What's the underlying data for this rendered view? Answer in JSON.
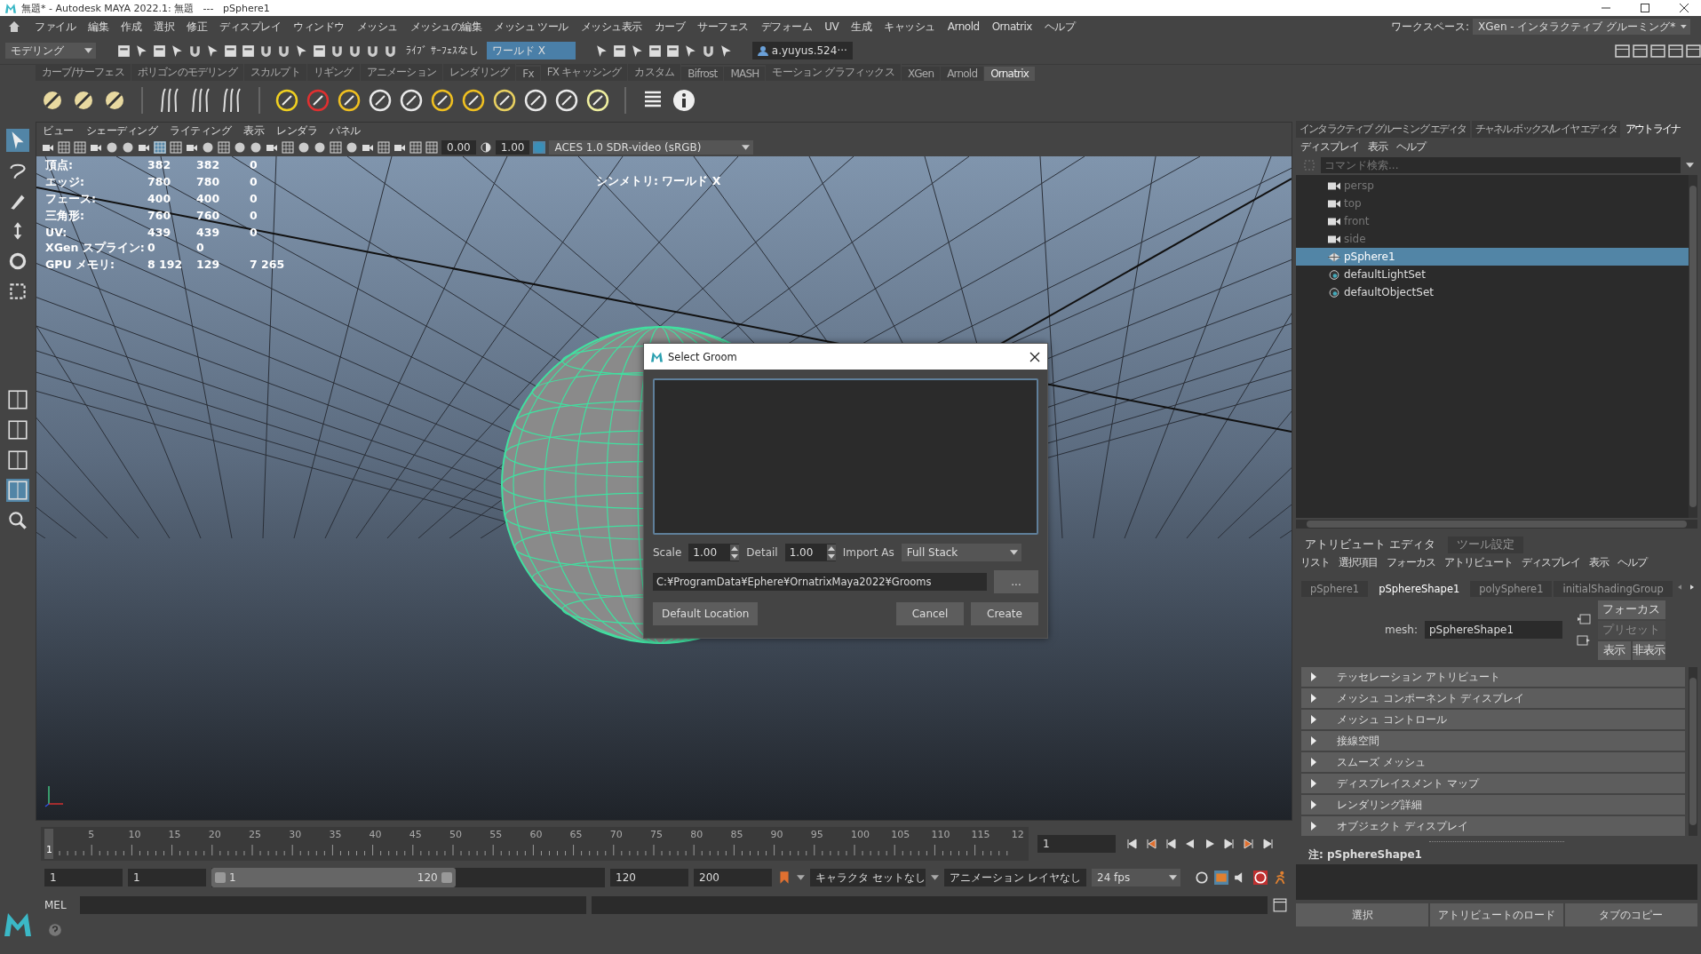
{
  "title_bar": {
    "title": "無題* - Autodesk MAYA 2022.1: 無題   ---   pSphere1"
  },
  "menu_bar": {
    "items": [
      "ファイル",
      "編集",
      "作成",
      "選択",
      "修正",
      "ディスプレイ",
      "ウィンドウ",
      "メッシュ",
      "メッシュの編集",
      "メッシュ ツール",
      "メッシュ表示",
      "カーブ",
      "サーフェス",
      "デフォーム",
      "UV",
      "生成",
      "キャッシュ",
      "Arnold",
      "Ornatrix",
      "ヘルプ"
    ],
    "workspace_label": "ワークスペース:",
    "workspace": "XGen - インタラクティブ グルーミング*"
  },
  "status_line": {
    "mode": "モデリング",
    "live_surface": "ﾗｲﾌﾞ ｻｰﾌｪｽなし",
    "symmetry": "ワールド X",
    "user": "a.yuyus.524···"
  },
  "shelf": {
    "tabs": [
      {
        "label": "カーブ/サーフェス",
        "selected": false
      },
      {
        "label": "ポリゴンのモデリング",
        "selected": false
      },
      {
        "label": "スカルプト",
        "selected": false
      },
      {
        "label": "リギング",
        "selected": false
      },
      {
        "label": "アニメーション",
        "selected": false
      },
      {
        "label": "レンダリング",
        "selected": false
      },
      {
        "label": "Fx",
        "selected": false
      },
      {
        "label": "FX キャッシング",
        "selected": false
      },
      {
        "label": "カスタム",
        "selected": false
      },
      {
        "label": "Bifrost",
        "selected": false
      },
      {
        "label": "MASH",
        "selected": false
      },
      {
        "label": "モーション グラフィックス",
        "selected": false
      },
      {
        "label": "XGen",
        "selected": false
      },
      {
        "label": "Arnold",
        "selected": false
      },
      {
        "label": "Ornatrix",
        "selected": true
      }
    ]
  },
  "viewport": {
    "menu": [
      "ビュー",
      "シェーディング",
      "ライティング",
      "表示",
      "レンダラ",
      "パネル"
    ],
    "exposure": "0.00",
    "gamma": "1.00",
    "color_space": "ACES 1.0 SDR-video (sRGB)",
    "hud": [
      {
        "label": "頂点:",
        "values": [
          "382",
          "382",
          "0"
        ]
      },
      {
        "label": "エッジ:",
        "values": [
          "780",
          "780",
          "0"
        ]
      },
      {
        "label": "フェース:",
        "values": [
          "400",
          "400",
          "0"
        ]
      },
      {
        "label": "三角形:",
        "values": [
          "760",
          "760",
          "0"
        ]
      },
      {
        "label": "UV:",
        "values": [
          "439",
          "439",
          "0"
        ]
      },
      {
        "label": "XGen スプライン:",
        "values": [
          "0",
          "0"
        ]
      },
      {
        "label": "GPU メモリ:",
        "values": [
          "8 192",
          "129",
          "7 265"
        ]
      }
    ],
    "symmetry_hud": "シンメトリ: ワールド X"
  },
  "dialog": {
    "title": "Select Groom",
    "scale_label": "Scale",
    "scale": "1.00",
    "detail_label": "Detail",
    "detail": "1.00",
    "import_label": "Import As",
    "import_as": "Full Stack",
    "path": "C:¥ProgramData¥Ephere¥OrnatrixMaya2022¥Grooms",
    "browse": "...",
    "default_location": "Default Location",
    "cancel": "Cancel",
    "create": "Create"
  },
  "outliner": {
    "tabs": [
      {
        "label": "インタラクティブ グルーミング エディタ",
        "selected": false
      },
      {
        "label": "チャネル ボックス/レイヤ エディタ",
        "selected": false
      },
      {
        "label": "アウトライナ",
        "selected": true
      }
    ],
    "menu": [
      "ディスプレイ",
      "表示",
      "ヘルプ"
    ],
    "search_placeholder": "コマンド検索...",
    "items": [
      {
        "label": "persp",
        "kind": "camera",
        "selected": false
      },
      {
        "label": "top",
        "kind": "camera",
        "selected": false
      },
      {
        "label": "front",
        "kind": "camera",
        "selected": false
      },
      {
        "label": "side",
        "kind": "camera",
        "selected": false
      },
      {
        "label": "pSphere1",
        "kind": "mesh",
        "selected": true
      },
      {
        "label": "defaultLightSet",
        "kind": "set",
        "selected": false
      },
      {
        "label": "defaultObjectSet",
        "kind": "set",
        "selected": false
      }
    ]
  },
  "attribute_editor": {
    "tabs": [
      {
        "label": "アトリビュート エディタ",
        "selected": true
      },
      {
        "label": "ツール設定",
        "selected": false
      }
    ],
    "menu": [
      "リスト",
      "選択項目",
      "フォーカス",
      "アトリビュート",
      "ディスプレイ",
      "表示",
      "ヘルプ"
    ],
    "node_tabs": [
      {
        "label": "pSphere1",
        "selected": false
      },
      {
        "label": "pSphereShape1",
        "selected": true
      },
      {
        "label": "polySphere1",
        "selected": false
      },
      {
        "label": "initialShadingGroup",
        "selected": false
      }
    ],
    "mesh_label": "mesh:",
    "mesh_value": "pSphereShape1",
    "side_buttons": [
      {
        "label": "フォーカス",
        "disabled": false
      },
      {
        "label": "プリセット",
        "disabled": true
      },
      {
        "label": "表示",
        "disabled": false
      },
      {
        "label": "非表示",
        "disabled": false
      }
    ],
    "sections": [
      {
        "label": "テッセレーション アトリビュート",
        "expanded": false
      },
      {
        "label": "メッシュ コンポーネント ディスプレイ",
        "expanded": false
      },
      {
        "label": "メッシュ コントロール",
        "expanded": false
      },
      {
        "label": "接線空間",
        "expanded": false
      },
      {
        "label": "スムーズ メッシュ",
        "expanded": false
      },
      {
        "label": "ディスプレイスメント マップ",
        "expanded": false
      },
      {
        "label": "レンダリング詳細",
        "expanded": false
      },
      {
        "label": "オブジェクト ディスプレイ",
        "expanded": false
      }
    ],
    "note": "注: pSphereShape1",
    "buttons": [
      "選択",
      "アトリビュートのロード",
      "タブのコピー"
    ]
  },
  "timeline": {
    "level": 0,
    "start": "1",
    "ticks": [
      "5",
      "10",
      "15",
      "20",
      "25",
      "30",
      "35",
      "40",
      "45",
      "50",
      "55",
      "60",
      "65",
      "70",
      "75",
      "80",
      "85",
      "90",
      "95",
      "100",
      "105",
      "110",
      "115",
      "12"
    ],
    "current_frame": "1"
  },
  "range": {
    "level": 0.62,
    "start": "1",
    "playback_start": "1",
    "slider_start": "1",
    "slider_end": "120",
    "playback_end": "120",
    "end": "200",
    "character_set": "キャラクタ セットなし",
    "anim_layer": "アニメーション レイヤなし",
    "fps": "24 fps"
  },
  "command_line": {
    "label": "MEL"
  }
}
